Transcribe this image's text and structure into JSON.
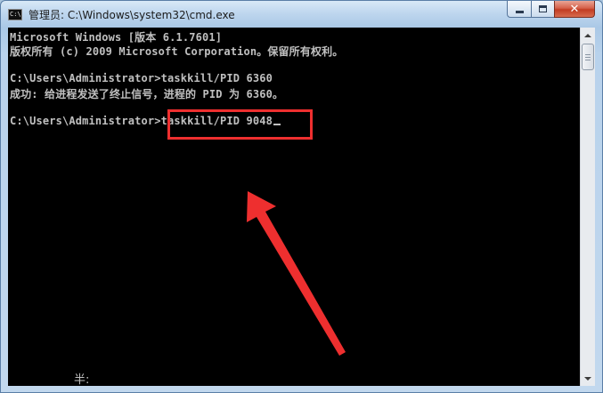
{
  "window": {
    "title": "管理员: C:\\Windows\\system32\\cmd.exe",
    "icon_label": "C:\\"
  },
  "caption_buttons": {
    "close_glyph": "✕"
  },
  "console": {
    "lines": [
      "Microsoft Windows [版本 6.1.7601]",
      "版权所有 (c) 2009 Microsoft Corporation。保留所有权利。",
      "",
      "C:\\Users\\Administrator>taskkill/PID 6360",
      "成功: 给进程发送了终止信号，进程的 PID 为 6360。",
      "",
      "C:\\Users\\Administrator>taskkill/PID 9048"
    ],
    "ime_status": "半:"
  },
  "annotation": {
    "highlight_color": "#ee2f2f",
    "arrow_color": "#ee2f2f"
  },
  "colors": {
    "console_bg": "#000000",
    "console_text": "#c0c0c0",
    "close_button": "#c94b32"
  }
}
